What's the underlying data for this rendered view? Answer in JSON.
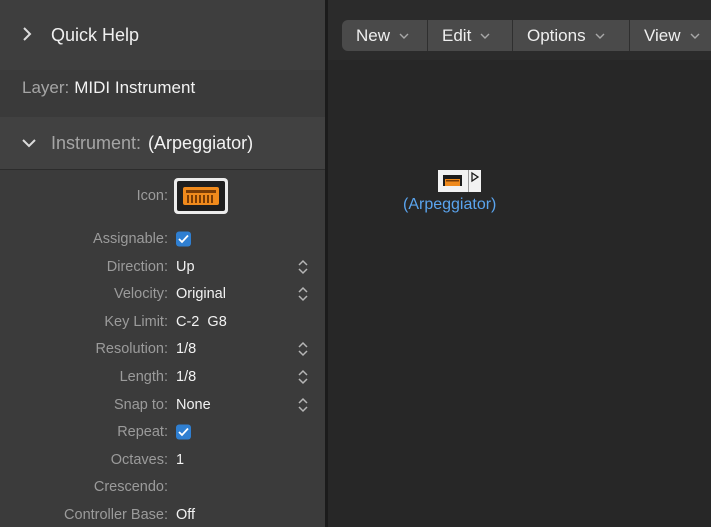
{
  "inspector": {
    "quick_help": "Quick Help",
    "layer_label": "Layer:",
    "layer_value": "MIDI Instrument",
    "instrument_label": "Instrument:",
    "instrument_value": "(Arpeggiator)",
    "params": {
      "icon": "Icon:",
      "assignable": "Assignable:",
      "direction": "Direction:",
      "direction_value": "Up",
      "velocity": "Velocity:",
      "velocity_value": "Original",
      "key_limit": "Key Limit:",
      "key_limit_value": "C-2  G8",
      "resolution": "Resolution:",
      "resolution_value": "1/8",
      "length": "Length:",
      "length_value": "1/8",
      "snap_to": "Snap to:",
      "snap_to_value": "None",
      "repeat": "Repeat:",
      "octaves": "Octaves:",
      "octaves_value": "1",
      "crescendo": "Crescendo:",
      "controller_base": "Controller Base:",
      "controller_base_value": "Off"
    },
    "assignable_checked": true,
    "repeat_checked": true
  },
  "environment": {
    "menus": [
      "New",
      "Edit",
      "Options",
      "View"
    ],
    "object_name": "(Arpeggiator)"
  },
  "colors": {
    "accent": "#2f7fd1",
    "object_label": "#5aa4ee",
    "icon_orange": "#f08a1c"
  }
}
